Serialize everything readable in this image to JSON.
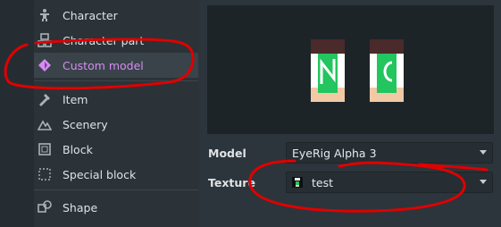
{
  "sidebar": {
    "items": [
      {
        "label": "Character",
        "icon": "character-icon"
      },
      {
        "label": "Character part",
        "icon": "character-part-icon"
      },
      {
        "label": "Custom model",
        "icon": "custom-model-icon",
        "selected": true
      },
      {
        "label": "Item",
        "icon": "item-icon"
      },
      {
        "label": "Scenery",
        "icon": "scenery-icon"
      },
      {
        "label": "Block",
        "icon": "block-icon"
      },
      {
        "label": "Special block",
        "icon": "special-block-icon"
      },
      {
        "label": "Shape",
        "icon": "shape-icon"
      }
    ]
  },
  "properties": {
    "model_label": "Model",
    "model_value": "EyeRig Alpha 3",
    "texture_label": "Texture",
    "texture_value": "test"
  },
  "colors": {
    "accent": "#d58cf2",
    "annotation": "#e00000"
  }
}
